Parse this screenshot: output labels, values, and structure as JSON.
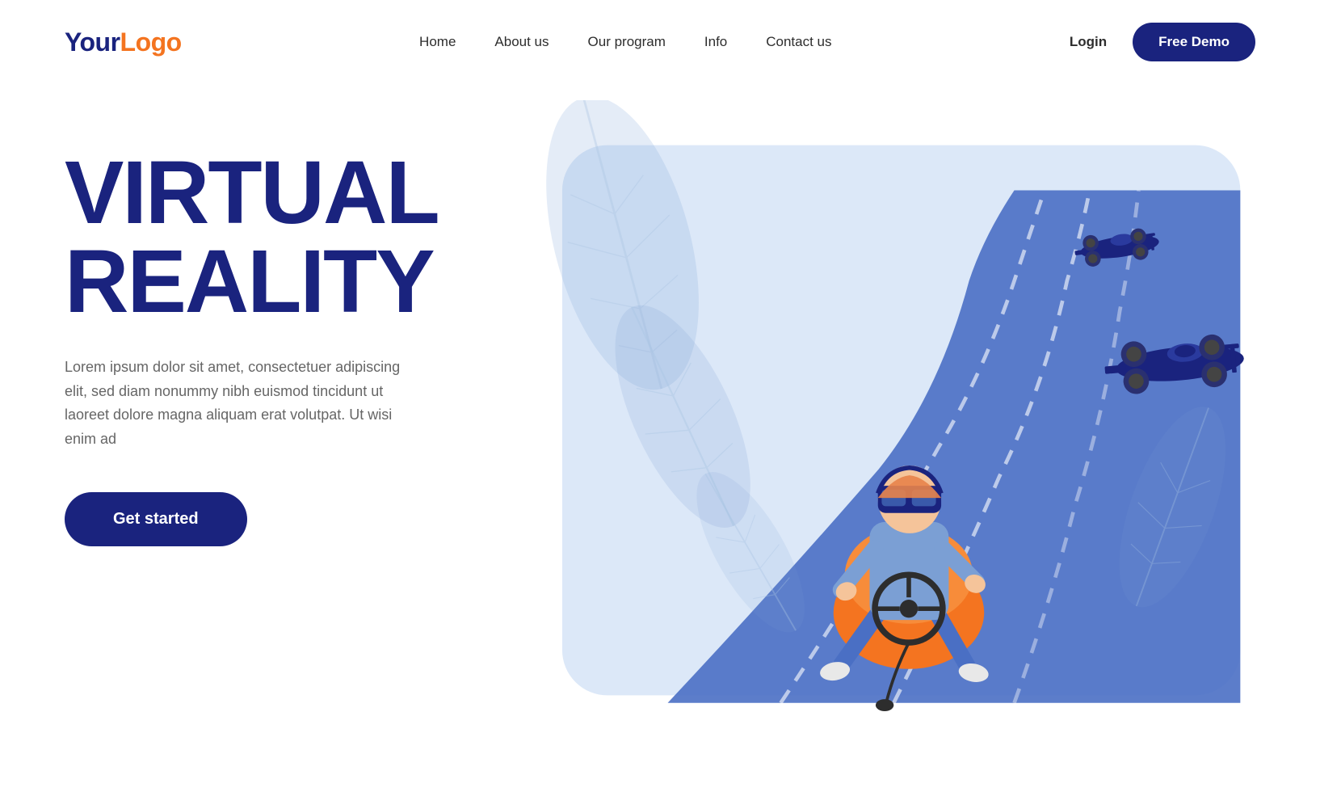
{
  "logo": {
    "your": "Your",
    "logo": "Logo"
  },
  "nav": {
    "items": [
      {
        "label": "Home",
        "id": "home"
      },
      {
        "label": "About us",
        "id": "about-us"
      },
      {
        "label": "Our program",
        "id": "our-program"
      },
      {
        "label": "Info",
        "id": "info"
      },
      {
        "label": "Contact us",
        "id": "contact-us"
      }
    ]
  },
  "header": {
    "login_label": "Login",
    "free_demo_label": "Free Demo"
  },
  "hero": {
    "title_line1": "VIRTUAL",
    "title_line2": "REALITY",
    "description": "Lorem ipsum dolor sit amet, consectetuer adipiscing elit, sed diam nonummy nibh euismod tincidunt ut laoreet dolore magna aliquam erat volutpat. Ut wisi enim ad",
    "cta_label": "Get started"
  },
  "colors": {
    "primary": "#1a237e",
    "orange": "#f47420",
    "light_blue": "#c5d5f0",
    "medium_blue": "#4a6fc4",
    "bg_blob": "#dce8f8"
  }
}
